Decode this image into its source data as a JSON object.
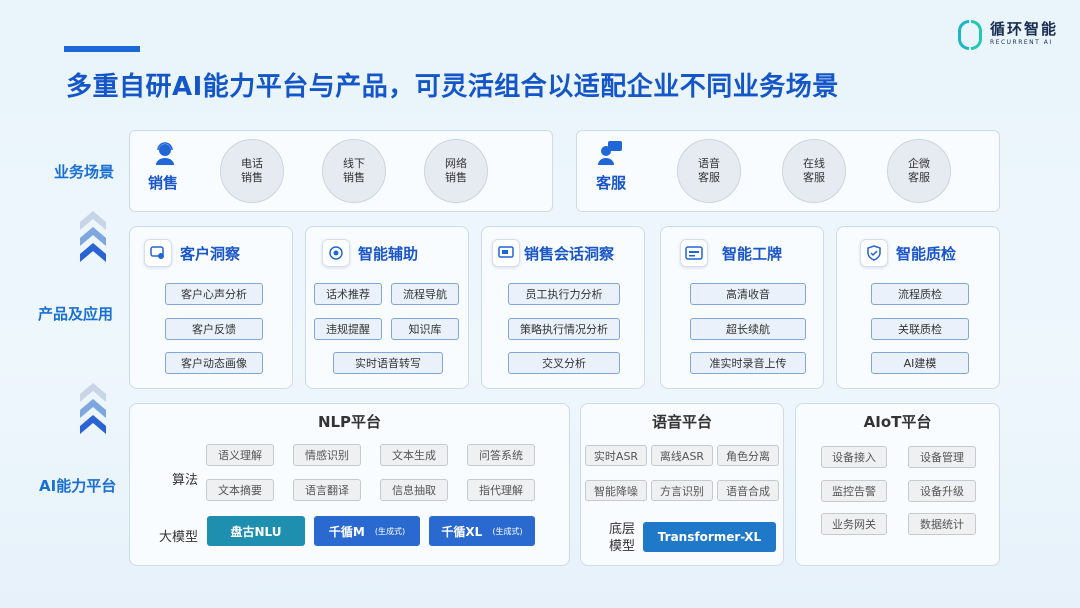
{
  "title": "多重自研AI能力平台与产品，可灵活组合以适配企业不同业务场景",
  "logo": {
    "cn": "循环智能",
    "en": "RECURRENT AI"
  },
  "rows": {
    "scenes": "业务场景",
    "products": "产品及应用",
    "platform": "AI能力平台"
  },
  "scenes": {
    "sales": {
      "label": "销售",
      "items": [
        "电话\n销售",
        "线下\n销售",
        "网络\n销售"
      ]
    },
    "service": {
      "label": "客服",
      "items": [
        "语音\n客服",
        "在线\n客服",
        "企微\n客服"
      ]
    }
  },
  "products": [
    {
      "title": "客户洞察",
      "icon": "chat-analysis-icon",
      "tags": [
        "客户心声分析",
        "客户反馈",
        "客户动态画像"
      ]
    },
    {
      "title": "智能辅助",
      "icon": "assistant-icon",
      "tags": [
        "话术推荐",
        "流程导航",
        "违规提醒",
        "知识库",
        "实时语音转写"
      ]
    },
    {
      "title": "销售会话洞察",
      "icon": "conversation-screen-icon",
      "tags": [
        "员工执行力分析",
        "策略执行情况分析",
        "交叉分析"
      ]
    },
    {
      "title": "智能工牌",
      "icon": "badge-card-icon",
      "tags": [
        "高清收音",
        "超长续航",
        "准实时录音上传"
      ]
    },
    {
      "title": "智能质检",
      "icon": "shield-check-icon",
      "tags": [
        "流程质检",
        "关联质检",
        "AI建模"
      ]
    }
  ],
  "nlp": {
    "title": "NLP平台",
    "algo_label": "算法",
    "algo": [
      "语义理解",
      "情感识别",
      "文本生成",
      "问答系统",
      "文本摘要",
      "语言翻译",
      "信息抽取",
      "指代理解"
    ],
    "model_label": "大模型",
    "models": [
      {
        "name": "盘古NLU",
        "note": ""
      },
      {
        "name": "千循M",
        "note": "(生成式)"
      },
      {
        "name": "千循XL",
        "note": "(生成式)"
      }
    ]
  },
  "speech": {
    "title": "语音平台",
    "tags": [
      "实时ASR",
      "离线ASR",
      "角色分离",
      "智能降噪",
      "方言识别",
      "语音合成"
    ],
    "base_label": "底层\n模型",
    "base_model": "Transformer-XL"
  },
  "aiot": {
    "title": "AIoT平台",
    "tags": [
      "设备接入",
      "设备管理",
      "监控告警",
      "设备升级",
      "业务网关",
      "数据统计"
    ]
  },
  "colors": {
    "accent": "#1f66d6",
    "teal": "#1bb6c8",
    "pangu": "#1e8fae",
    "qianxun": "#2a6ad0",
    "transformer": "#1f78c8"
  }
}
